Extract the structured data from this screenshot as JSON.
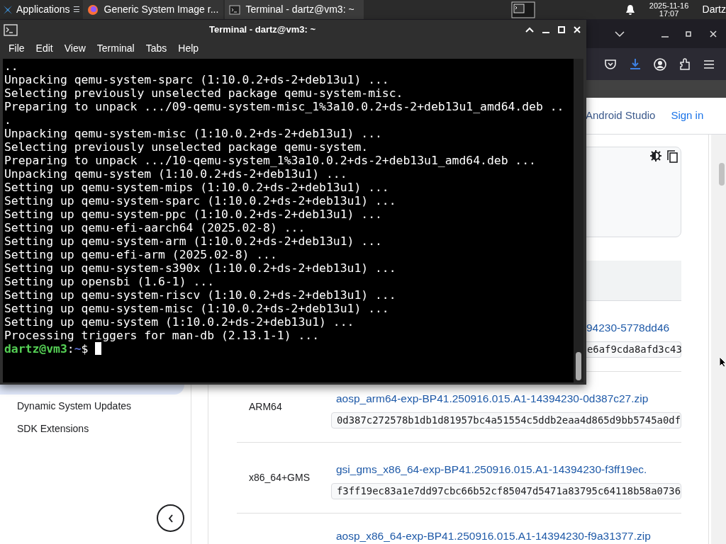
{
  "taskbar": {
    "apps_label": "Applications",
    "menu_glyph": "☰",
    "tasks": [
      {
        "label": "Generic System Image r...",
        "kind": "browser",
        "selected": false
      },
      {
        "label": "Terminal - dartz@vm3: ~",
        "kind": "terminal",
        "selected": true
      }
    ],
    "date": "2025-11-16",
    "time": "17:07",
    "user": "Dartz"
  },
  "browser": {
    "nav": [
      "Android Studio",
      "Sign in"
    ],
    "sidebar": [
      {
        "label": "Dynamic System Updates"
      },
      {
        "label": "SDK Extensions"
      }
    ],
    "rows": [
      {
        "arch": "",
        "link": "94230-5778dd46",
        "hash": "e6af9cda8afd3c43"
      },
      {
        "arch": "ARM64",
        "link": "aosp_arm64-exp-BP41.250916.015.A1-14394230-0d387c27.zip",
        "hash": "0d387c272578b1db1d81957bc4a51554c5ddb2eaa4d865d9bb5745a0df"
      },
      {
        "arch": "x86_64+GMS",
        "link": "gsi_gms_x86_64-exp-BP41.250916.015.A1-14394230-f3ff19ec.",
        "hash": "f3ff19ec83a1e7dd97cbc66b52cf85047d5471a83795c64118b58a0736"
      },
      {
        "arch": "",
        "link": "aosp_x86_64-exp-BP41.250916.015.A1-14394230-f9a31377.zip",
        "hash": ""
      }
    ]
  },
  "terminal": {
    "title": "Terminal - dartz@vm3: ~",
    "menu": [
      "File",
      "Edit",
      "View",
      "Terminal",
      "Tabs",
      "Help"
    ],
    "lines": [
      "..",
      "Unpacking qemu-system-sparc (1:10.0.2+ds-2+deb13u1) ...",
      "Selecting previously unselected package qemu-system-misc.",
      "Preparing to unpack .../09-qemu-system-misc_1%3a10.0.2+ds-2+deb13u1_amd64.deb ..",
      ".",
      "Unpacking qemu-system-misc (1:10.0.2+ds-2+deb13u1) ...",
      "Selecting previously unselected package qemu-system.",
      "Preparing to unpack .../10-qemu-system_1%3a10.0.2+ds-2+deb13u1_amd64.deb ...",
      "Unpacking qemu-system (1:10.0.2+ds-2+deb13u1) ...",
      "Setting up qemu-system-mips (1:10.0.2+ds-2+deb13u1) ...",
      "Setting up qemu-system-sparc (1:10.0.2+ds-2+deb13u1) ...",
      "Setting up qemu-system-ppc (1:10.0.2+ds-2+deb13u1) ...",
      "Setting up qemu-efi-aarch64 (2025.02-8) ...",
      "Setting up qemu-system-arm (1:10.0.2+ds-2+deb13u1) ...",
      "Setting up qemu-efi-arm (2025.02-8) ...",
      "Setting up qemu-system-s390x (1:10.0.2+ds-2+deb13u1) ...",
      "Setting up opensbi (1.6-1) ...",
      "Setting up qemu-system-riscv (1:10.0.2+ds-2+deb13u1) ...",
      "Setting up qemu-system-misc (1:10.0.2+ds-2+deb13u1) ...",
      "Setting up qemu-system (1:10.0.2+ds-2+deb13u1) ...",
      "Processing triggers for man-db (2.13.1-1) ..."
    ],
    "prompt": {
      "user_host": "dartz@vm3",
      "separator": ":",
      "path": "~",
      "symbol": "$"
    }
  }
}
